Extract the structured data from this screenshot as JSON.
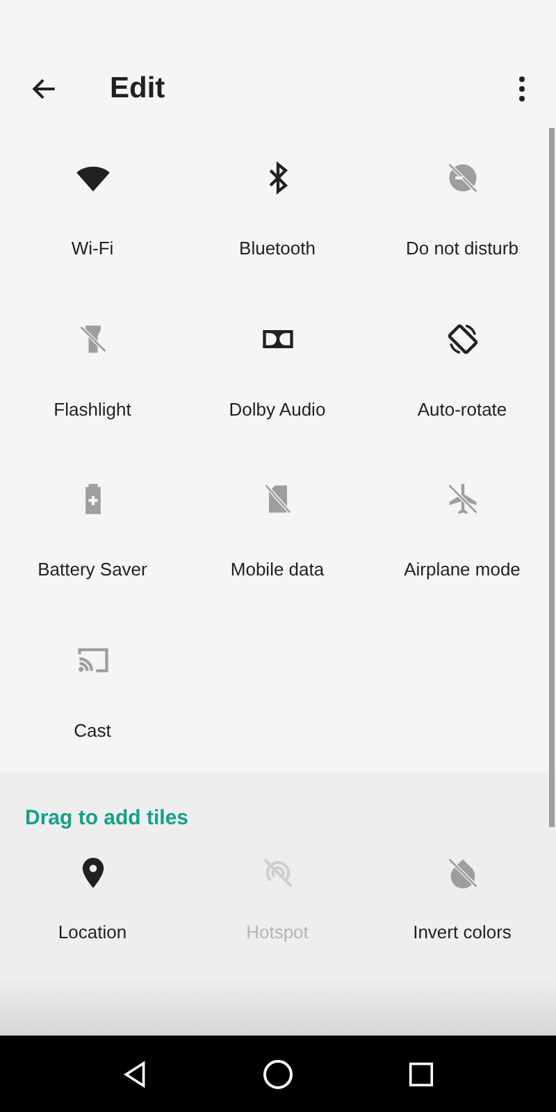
{
  "header": {
    "title": "Edit"
  },
  "tiles": [
    {
      "kind": "wifi",
      "label": "Wi-Fi",
      "on": true
    },
    {
      "kind": "bluetooth",
      "label": "Bluetooth",
      "on": true
    },
    {
      "kind": "dnd",
      "label": "Do not disturb",
      "on": false
    },
    {
      "kind": "flashlight",
      "label": "Flashlight",
      "on": false
    },
    {
      "kind": "dolby",
      "label": "Dolby Audio",
      "on": true
    },
    {
      "kind": "rotate",
      "label": "Auto-rotate",
      "on": true
    },
    {
      "kind": "battery",
      "label": "Battery Saver",
      "on": false
    },
    {
      "kind": "mobiledata",
      "label": "Mobile data",
      "on": false
    },
    {
      "kind": "airplane",
      "label": "Airplane mode",
      "on": false
    },
    {
      "kind": "cast",
      "label": "Cast",
      "on": false
    }
  ],
  "add_section": {
    "heading": "Drag to add tiles",
    "tiles": [
      {
        "kind": "location",
        "label": "Location",
        "on": true,
        "disabled": false
      },
      {
        "kind": "hotspot",
        "label": "Hotspot",
        "on": false,
        "disabled": true
      },
      {
        "kind": "invert",
        "label": "Invert colors",
        "on": false,
        "disabled": false
      }
    ]
  }
}
